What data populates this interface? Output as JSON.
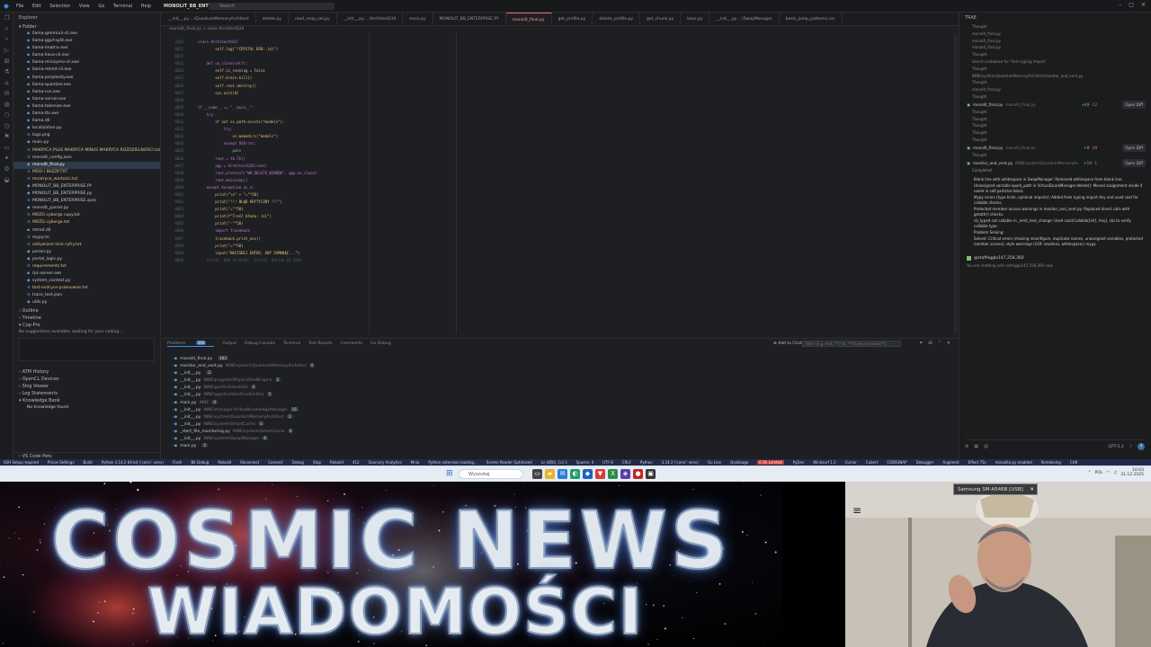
{
  "titlebar": {
    "menu": [
      "File",
      "Edit",
      "Selection",
      "View",
      "Go",
      "Terminal",
      "Help"
    ],
    "project": "MONOLIT_BB_ENTERPRISE",
    "search": "Search"
  },
  "explorer": {
    "header": "Explorer",
    "folder_label": "Folder",
    "files": [
      "llama-gemma3-cli.exe",
      "llama-gguf-split.exe",
      "llama-imatrix.exe",
      "llama-llava-cli.exe",
      "llama-minicpmv-cli.exe",
      "llama-mtmd-cli.exe",
      "llama-perplexity.exe",
      "llama-quantize.exe",
      "llama-run.exe",
      "llama-server.exe",
      "llama-tokenize.exe",
      "llama-tts.exe",
      "llama.dll",
      "localization.py",
      "logo.png",
      "main.py",
      "MAKRYCA PLUS MAKRYCA MINUS MAKRYCA ROZDZIELNOŚCI.txt",
      "monolit_config.json",
      "monolit_final.py",
      "MSGI I BŁĘDY.TXT",
      "mnatryca_wartości.txt",
      "MONOLIT_BB_ENTERPRISE.PY",
      "MONOLIT_BB_ENTERPRISE.py",
      "MONOLIT_BB_ENTERPRISE.spec",
      "monolit_parser.py",
      "MÓZG cyborga copy.txt",
      "MÓZG cyborga.txt",
      "mtmd.dll",
      "mypy.ini",
      "odżywione linie cyfry.txt",
      "parser.py",
      "portal_logic.py",
      "requirements.txt",
      "rpc-server.exe",
      "system_context.py",
      "test-esdryce-przesuwne.txt",
      "trace_test.json",
      "utils.py"
    ],
    "sections": [
      "Outline",
      "Timeline"
    ],
    "copilot_label": "Cop-Pro",
    "copilot_text": "No suggestions available, waiting for your coding...",
    "bottom_sections": [
      "ATM History",
      "OpenCL Devices",
      "Slog Viewer",
      "Log Statements",
      "Knowledge Bank"
    ],
    "knowledge_empty": "No knowledge found",
    "footer": "VS Code Pets"
  },
  "tabs": [
    "__init__.py ...\\QuantumMemoryArchitect",
    "delete.py",
    "read_snap_sel.py",
    "__init__.py ...\\ArchitectGUI",
    "main.py",
    "MONOLIT_BB_ENTERPRISE.PY",
    "monolit_final.py",
    "get_profile.py",
    "delete_profile.py",
    "get_chunk.py",
    "keys.py",
    "__init__.py ...\\SwapManager",
    "basic_jump_patterns.css"
  ],
  "active_tab": "monolit_final.py",
  "breadcrumbs": "monolit_final.py > class ArchitectGUI",
  "editor": {
    "line_numbers": [
      "2342",
      "4821",
      "4822",
      "4823",
      "4824",
      "4825",
      "4826",
      "4827",
      "4828",
      "4829",
      "4830",
      "4831",
      "4832",
      "4833",
      "4834",
      "4835",
      "4836",
      "4837",
      "4838",
      "4839",
      "4840",
      "4841",
      "4842",
      "4843",
      "4844",
      "4845",
      "4846",
      "4847",
      "4848",
      "4849",
      "4850"
    ],
    "lines": [
      "class ArchitectGUI:",
      "        self.log(\"!CRYSTAL ERR: {e}\")",
      "",
      "    def on_close(self):",
      "        self.is_running = False",
      "        self.brain.kill()",
      "        self.root.destroy()",
      "        sys.exit(0)",
      "",
      "if __name__ == \"__main__\":",
      "    try:",
      "        if not os.path.exists(\"models\"):",
      "            try:",
      "                os.makedirs(\"models\")",
      "            except OSError:",
      "                pass",
      "        root = tk.Tk()",
      "        app = ArchitectGUI(root)",
      "        root.protocol(\"WM_DELETE_WINDOW\", app.on_close)",
      "        root.mainloop()",
      "    except Exception as e:",
      "        print(\"\\n\" + \"=\"*50)",
      "        print(\"!!! BŁĄD KRYTYCZNY !!!\")",
      "        print(\"=\"*50)",
      "        print(f\"Treść błędu: {e}\")",
      "        print(\"-\"*50)",
      "        import traceback",
      "        traceback.print_exc()",
      "        print(\"=\"*50)",
      "        input(\"NACIŚNIJ ENTER, ABY ZAMKNĄĆ...\")",
      "    Ctrl+L  Add to Chat,  Ctrl+I  Inline AI Chat"
    ]
  },
  "panel": {
    "tabs": [
      "Problems",
      "Output",
      "Debug Console",
      "Terminal",
      "Test Results",
      "Comments",
      "Go Debug"
    ],
    "problems_count": "260",
    "add_to_chat": "Add to Chat",
    "filter_placeholder": "Filter (e.g. text, **/*.ts, !**/node_modules/**)",
    "problems": [
      {
        "file": "monolit_final.py",
        "path": "",
        "count": "183"
      },
      {
        "file": "monitor_and_vent.py",
        "path": "INNE\\system\\QuantumMemoryArchitect",
        "count": "4"
      },
      {
        "file": "__init__.py",
        "path": "",
        "count": "2"
      },
      {
        "file": "__init__.py",
        "path": "INNE\\program\\PhysicsShellEngine",
        "count": "2"
      },
      {
        "file": "__init__.py",
        "path": "INNE\\gui\\ArchitectGUI",
        "count": "4"
      },
      {
        "file": "__init__.py",
        "path": "INNE\\app\\ArchitectCodeEditor",
        "count": "5"
      },
      {
        "file": "main.py",
        "path": "INNE",
        "count": "4"
      },
      {
        "file": "__init__.py",
        "path": "INNE\\manager\\VirtualKnowledgeManager",
        "count": "16"
      },
      {
        "file": "__init__.py",
        "path": "INNE\\system\\QuantumMemoryArchitect",
        "count": "2"
      },
      {
        "file": "__init__.py",
        "path": "INNE\\system\\SmartCache",
        "count": "1"
      },
      {
        "file": "_start_file_monitoring.py",
        "path": "INNE\\system\\SmartCache",
        "count": "4"
      },
      {
        "file": "__init__.py",
        "path": "INNE\\system\\SwapManager",
        "count": "6"
      },
      {
        "file": "main.py",
        "path": "",
        "count": "5"
      }
    ]
  },
  "chat": {
    "header": "TRAE",
    "entries_top": [
      "Thought",
      "monolit_final.py",
      "monolit_final.py",
      "monolit_final.py",
      "Thought",
      "Search codebase for 'from typing import'",
      "Thought",
      "INNE\\system\\QuantumMemoryArchitect\\monitor_and_vent.py",
      "Thought",
      "monolit_final.py",
      "Thought"
    ],
    "edit1": {
      "file": "monolit_final.py",
      "path": "monolit_final.py",
      "added": "+49",
      "removed": "-12",
      "open": "Open Diff"
    },
    "entries_mid": [
      "Thought",
      "Thought",
      "Thought",
      "Thought",
      "Thought"
    ],
    "edit2": {
      "file": "monolit_final.py",
      "path": "monolit_final.py",
      "added": "+9",
      "removed": "-39",
      "open": "Open Diff"
    },
    "entries_mid2": [
      "Thought"
    ],
    "edit3": {
      "file": "monitor_and_vent.py",
      "path": "INNE\\system\\QuantumMemoryArchitect\\monitor_and_vent.py",
      "added": "+10",
      "removed": "-1",
      "open": "Open Diff"
    },
    "completed": "Completed",
    "bullets": [
      "Blank line with whitespace in SwapManager: Removed whitespace from blank line.",
      "Unassigned variable quark_path in VirtualQuarkManager.delete(): Moved assignment inside if name in self.particles block.",
      "Mypy errors (type hints, optional imports): Added from typing import Any and used cast for callable checks.",
      "Protected member access warnings in monitor_and_vent.py: Replaced direct calls with getattr() checks.",
      "cb_typed not callable in _emit_text_change: Used cast(Callable[[str], Any], cb) to verify callable type.",
      "Problem Solving:",
      "Solved: Critical errors (missing reconfigure, duplicate names, unassigned variables, protected member access); style warnings (GOF newlines, whitespace); mypy"
    ],
    "user": "@staffegglo147,258,360",
    "user_note": "You are chatting with solteggo147,258,360 now",
    "model": "GPT-5.2"
  },
  "statusbar": {
    "items": [
      "SSH Setup required",
      "Pricos Settings",
      "Build",
      "Python 3.14.2 64-bit ('conv': venv)",
      "Flash",
      "Bit Debug",
      "Rebuild",
      "Reconnect",
      "Connect",
      "Debug",
      "Stop",
      "Rebuild",
      "412",
      "Sourcery Analytics",
      "Mnia",
      "Python extension loading...",
      "Screen Reader Optimized",
      "Ln 4850, Col 3",
      "Spaces: 4",
      "UTF-8",
      "CRLF",
      "Python",
      "3.14.2 ('conv': venv)",
      "Go Live",
      "Quokkaga",
      "6 Ok Limited",
      "PyDev",
      "Windsurf 1.2",
      "Cursor",
      "Cubert",
      "CODESNAP",
      "Debugger",
      "Augment",
      "Effect 75s",
      "monolito.py enabled",
      "Reindexing",
      "CHK"
    ],
    "warn": "6 Ok Limited"
  },
  "taskbar": {
    "search": "Wyszukaj",
    "lang": "POL",
    "time": "10:03",
    "date": "31.12.2025"
  },
  "banner": {
    "line1": "COSMIC NEWS",
    "line2": "WIADOMOŚCI"
  },
  "webcam": {
    "device": "Samsung SM-A546B [USB]"
  }
}
